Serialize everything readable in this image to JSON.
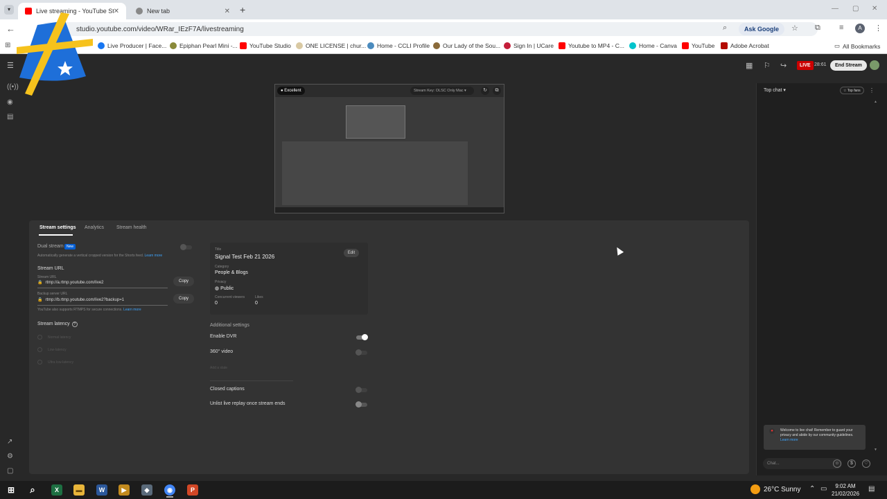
{
  "browser": {
    "tabs": [
      {
        "label": "Live streaming - YouTube Studio",
        "favicon_color": "#ff0000"
      },
      {
        "label": "New tab",
        "favicon_color": "#888888"
      }
    ],
    "new_tab_icon": "plus-icon",
    "url": "studio.youtube.com/video/WRar_IEzF7A/livestreaming",
    "ask_google": "Ask Google",
    "profile_initial": "A",
    "bookmarks": [
      {
        "label": "Live Producer | Face...",
        "color": "#1877f2"
      },
      {
        "label": "Epiphan Pearl Mini -...",
        "color": "#8a8a3a"
      },
      {
        "label": "YouTube Studio",
        "color": "#ff0000"
      },
      {
        "label": "ONE LICENSE | chur...",
        "color": "#d9c9a3"
      },
      {
        "label": "Home - CCLI Profile",
        "color": "#4b8bbe"
      },
      {
        "label": "Our Lady of the Sou...",
        "color": "#8a6a3a"
      },
      {
        "label": "Sign In | UCare",
        "color": "#c41e3a"
      },
      {
        "label": "Youtube to MP4 - C...",
        "color": "#ff0000"
      },
      {
        "label": "Home - Canva",
        "color": "#00c4cc"
      },
      {
        "label": "YouTube",
        "color": "#ff0000"
      },
      {
        "label": "Adobe Acrobat",
        "color": "#b30b00"
      }
    ],
    "all_bookmarks": "All Bookmarks"
  },
  "header": {
    "live_label": "LIVE",
    "live_time": "28:61",
    "end_stream": "End Stream"
  },
  "preview": {
    "quality": "Excellent",
    "stream_key": "Stream Key: OLSC Only Mac"
  },
  "settings": {
    "tabs": [
      "Stream settings",
      "Analytics",
      "Stream health"
    ],
    "dual_stream": {
      "label": "Dual stream",
      "badge": "New",
      "description": "Automatically generate a vertical cropped version for the Shorts feed.",
      "learn_more": "Learn more"
    },
    "stream_url": {
      "heading": "Stream URL",
      "url_label": "Stream URL",
      "url_value": "rtmp://a.rtmp.youtube.com/live2",
      "backup_label": "Backup server URL",
      "backup_value": "rtmp://b.rtmp.youtube.com/live2?backup=1",
      "copy": "Copy",
      "note": "YouTube also supports RTMPS for secure connections.",
      "note_link": "Learn more"
    },
    "latency": {
      "heading": "Stream latency",
      "options": [
        "Normal latency",
        "Low-latency",
        "Ultra low-latency"
      ]
    },
    "info": {
      "title_label": "Title",
      "title_value": "Signal Test Feb 21 2026",
      "edit": "Edit",
      "category_label": "Category",
      "category_value": "People & Blogs",
      "privacy_label": "Privacy",
      "privacy_value": "Public",
      "concurrent_label": "Concurrent viewers",
      "concurrent_value": "0",
      "likes_label": "Likes",
      "likes_value": "0"
    },
    "additional": {
      "heading": "Additional settings",
      "dvr": "Enable DVR",
      "video360": "360° video",
      "add_ad": "Add a slate",
      "closed_captions": "Closed captions",
      "unlist": "Unlist live replay once stream ends"
    }
  },
  "chat": {
    "title": "Top chat",
    "top_fans": "Top fans",
    "welcome": "Welcome to live chat! Remember to guard your privacy and abide by our community guidelines.",
    "learn_more": "Learn more",
    "placeholder": "Chat..."
  },
  "taskbar": {
    "weather": "26°C  Sunny",
    "time": "9:02 AM",
    "date": "21/02/2026",
    "apps": [
      {
        "name": "excel",
        "color": "#1d6f42",
        "glyph": "X"
      },
      {
        "name": "file-explorer",
        "color": "#e8b53a",
        "glyph": "▬"
      },
      {
        "name": "word",
        "color": "#2b579a",
        "glyph": "W"
      },
      {
        "name": "media-app",
        "color": "#c28a1e",
        "glyph": "▶"
      },
      {
        "name": "vpn-app",
        "color": "#5a6a7a",
        "glyph": "◆"
      },
      {
        "name": "chrome",
        "color": "#4285f4",
        "glyph": "◉"
      },
      {
        "name": "powerpoint",
        "color": "#d24726",
        "glyph": "P"
      }
    ]
  },
  "colors": {
    "accent_blue": "#065fd4",
    "live_red": "#cc0000",
    "logo_blue": "#1e6fd9",
    "logo_yellow": "#f6c21c"
  }
}
